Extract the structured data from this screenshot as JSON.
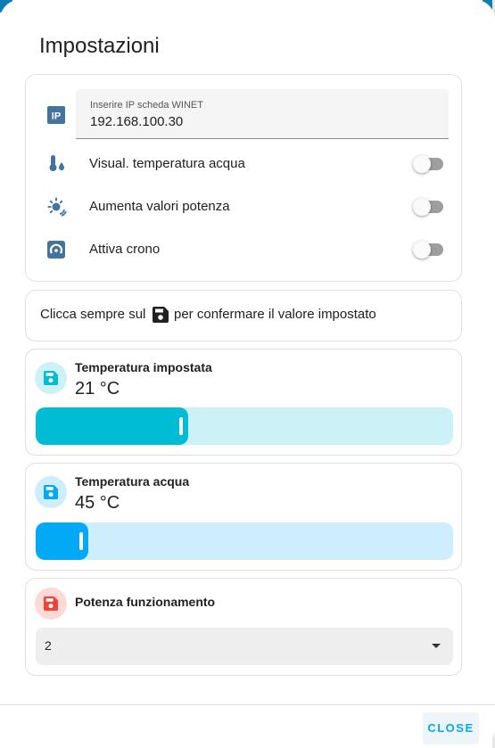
{
  "dialog": {
    "title": "Impostazioni"
  },
  "settings": {
    "ip": {
      "label": "Inserire IP scheda WINET",
      "value": "192.168.100.30",
      "icon": "ip-icon"
    },
    "rows": [
      {
        "label": "Visual. temperatura acqua",
        "icon": "water-thermometer-icon",
        "checked": false
      },
      {
        "label": "Aumenta valori potenza",
        "icon": "sun-wireless-icon",
        "checked": false
      },
      {
        "label": "Attiva crono",
        "icon": "crono-icon",
        "checked": false
      }
    ]
  },
  "info": {
    "before": "Clicca sempre sul",
    "after": "per confermare il valore impostato",
    "icon": "content-save-icon"
  },
  "tiles": [
    {
      "name": "Temperatura impostata",
      "value": "21 °C",
      "fraction": 0.366,
      "color": "#00bcd4",
      "track": "#ccf1f7",
      "bubble": "#ccf1f7",
      "icon": "content-save-icon"
    },
    {
      "name": "Temperatura acqua",
      "value": "45 °C",
      "fraction": 0.126,
      "color": "#03a9f4",
      "track": "#cfeefd",
      "bubble": "#cfeefd",
      "icon": "content-save-icon"
    }
  ],
  "power": {
    "name": "Potenza funzionamento",
    "selected": "2",
    "color": "#f44336",
    "bubble": "#fdd9d7",
    "icon": "content-save-icon"
  },
  "footer": {
    "close_label": "CLOSE"
  }
}
